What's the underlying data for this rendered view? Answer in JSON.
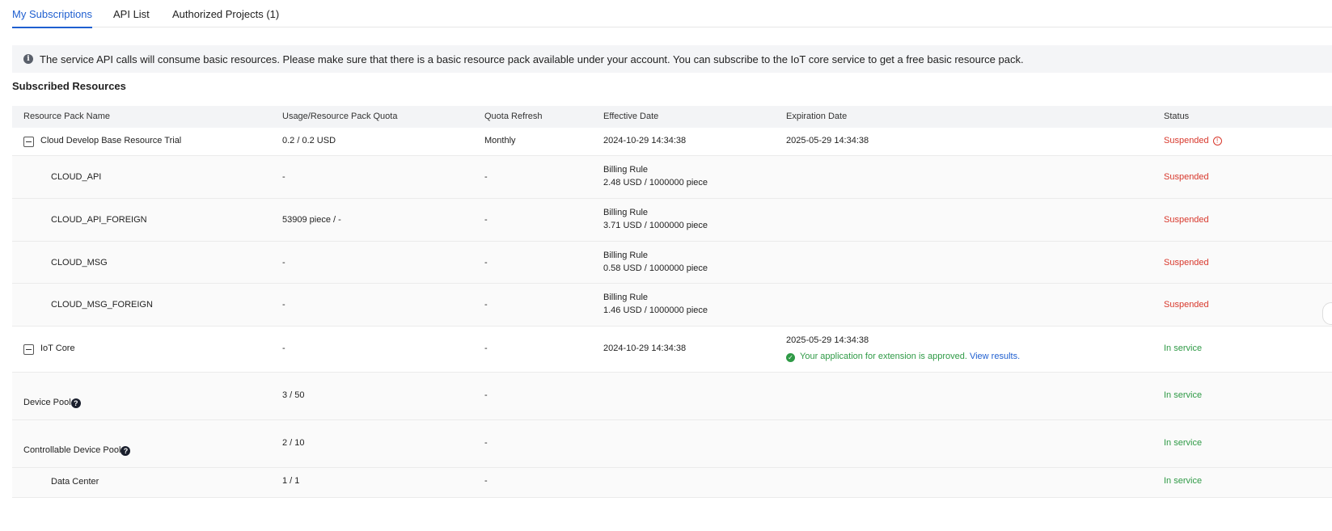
{
  "tabs": {
    "subscriptions": "My Subscriptions",
    "api_list": "API List",
    "authorized": "Authorized Projects (1)"
  },
  "notice": "The service API calls will consume basic resources. Please make sure that there is a basic resource pack available under your account. You can subscribe to the IoT core service to get a free basic resource pack.",
  "section_title": "Subscribed Resources",
  "columns": {
    "name": "Resource Pack Name",
    "usage": "Usage/Resource Pack Quota",
    "refresh": "Quota Refresh",
    "effective": "Effective Date",
    "expiration": "Expiration Date",
    "status": "Status"
  },
  "rows": [
    {
      "name": "Cloud Develop Base Resource Trial",
      "usage": "0.2 / 0.2 USD",
      "refresh": "Monthly",
      "effective": "2024-10-29 14:34:38",
      "expiration": "2025-05-29 14:34:38",
      "status": "Suspended"
    },
    {
      "name": "CLOUD_API",
      "usage": "-",
      "refresh": "-",
      "billing_label": "Billing Rule",
      "billing": "2.48 USD / 1000000 piece",
      "status": "Suspended"
    },
    {
      "name": "CLOUD_API_FOREIGN",
      "usage": "53909 piece / -",
      "refresh": "-",
      "billing_label": "Billing Rule",
      "billing": "3.71 USD / 1000000 piece",
      "status": "Suspended"
    },
    {
      "name": "CLOUD_MSG",
      "usage": "-",
      "refresh": "-",
      "billing_label": "Billing Rule",
      "billing": "0.58 USD / 1000000 piece",
      "status": "Suspended"
    },
    {
      "name": "CLOUD_MSG_FOREIGN",
      "usage": "-",
      "refresh": "-",
      "billing_label": "Billing Rule",
      "billing": "1.46 USD / 1000000 piece",
      "status": "Suspended"
    },
    {
      "name": "IoT Core",
      "usage": "-",
      "refresh": "-",
      "effective": "2024-10-29 14:34:38",
      "expiration": "2025-05-29 14:34:38",
      "approved": "Your application for extension is approved.",
      "view_results": "View results.",
      "status": "In service"
    },
    {
      "name": "Device Pool",
      "usage": "3 / 50",
      "refresh": "-",
      "status": "In service"
    },
    {
      "name": "Controllable Device Pool",
      "usage": "2 / 10",
      "refresh": "-",
      "status": "In service"
    },
    {
      "name": "Data Center",
      "usage": "1 / 1",
      "refresh": "-",
      "status": "In service"
    }
  ],
  "colors": {
    "accent": "#1f5fd0",
    "suspended": "#d8382c",
    "in_service": "#2f9a46"
  }
}
